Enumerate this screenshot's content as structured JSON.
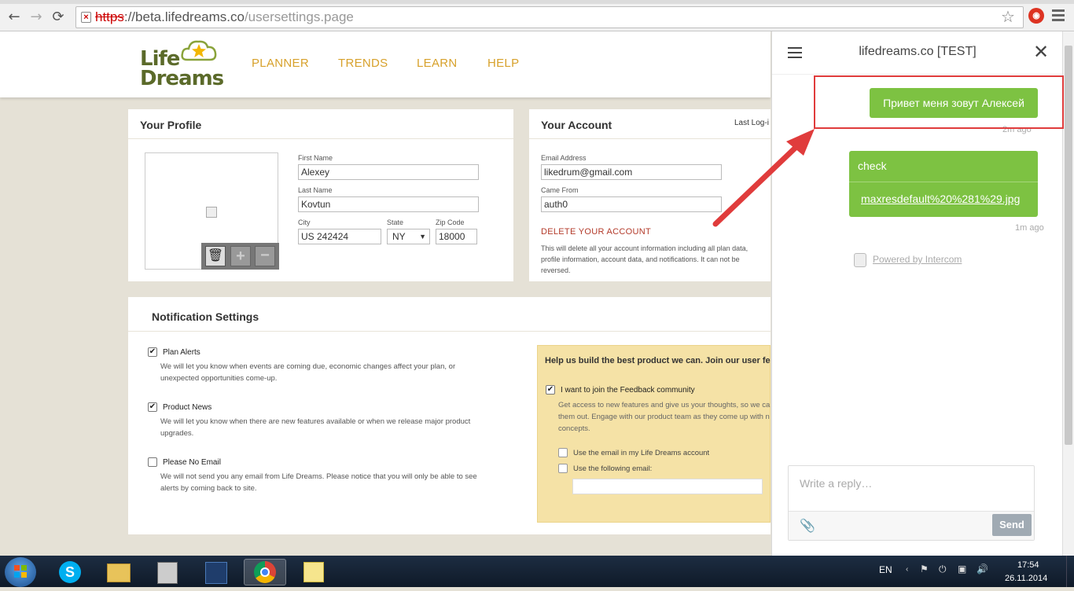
{
  "browser": {
    "url_scheme": "https",
    "url_sep": "://",
    "url_host": "beta.lifedreams.co",
    "url_path": "/usersettings.page"
  },
  "site": {
    "logo_line1": "Life",
    "logo_line2": "Dreams",
    "nav": [
      "PLANNER",
      "TRENDS",
      "LEARN",
      "HELP"
    ]
  },
  "profile": {
    "title": "Your Profile",
    "first_name_label": "First Name",
    "first_name": "Alexey",
    "last_name_label": "Last Name",
    "last_name": "Kovtun",
    "city_label": "City",
    "city": "US 242424",
    "state_label": "State",
    "state": "NY",
    "zip_label": "Zip Code",
    "zip": "18000"
  },
  "account": {
    "title": "Your Account",
    "last_login": "Last Log-i",
    "email_label": "Email Address",
    "email": "likedrum@gmail.com",
    "came_from_label": "Came From",
    "came_from": "auth0",
    "delete_label": "DELETE YOUR ACCOUNT",
    "delete_desc": "This will delete all your account information including all plan data, profile information, account data, and notifications. It can not be reversed."
  },
  "notifications": {
    "title": "Notification Settings",
    "items": [
      {
        "label": "Plan Alerts",
        "checked": true,
        "desc": "We will let you know when events are coming due, economic changes affect your plan, or unexpected opportunities come-up."
      },
      {
        "label": "Product News",
        "checked": true,
        "desc": "We will let you know when there are new features available or when we release major product upgrades."
      },
      {
        "label": "Please No Email",
        "checked": false,
        "desc": "We will not send you any email from Life Dreams. Please notice that you will only be able to see alerts by coming back to site."
      }
    ],
    "feedback_title": "Help us build the best product we can. Join our user fe",
    "feedback_join": "I want to join the Feedback community",
    "feedback_desc": "Get access to new features and give us your thoughts, so we ca them out. Engage with our product team as they come up with n concepts.",
    "use_account_email": "Use the email in my Life Dreams account",
    "use_following_email": "Use the following email:"
  },
  "intercom": {
    "title": "lifedreams.co [TEST]",
    "msg1": "Привет меня зовут Алексей",
    "msg1_time": "2m ago",
    "msg2": "check",
    "msg2_link": "maxresdefault%20%281%29.jpg",
    "msg2_time": "1m ago",
    "powered": "Powered by Intercom",
    "reply_placeholder": "Write a reply…",
    "send": "Send"
  },
  "taskbar": {
    "lang": "EN",
    "time": "17:54",
    "date": "26.11.2014"
  },
  "colors": {
    "accent_green": "#7dc242",
    "nav_gold": "#d7a12b",
    "annotation_red": "#e03c3c",
    "delete_red": "#b33a2a"
  }
}
